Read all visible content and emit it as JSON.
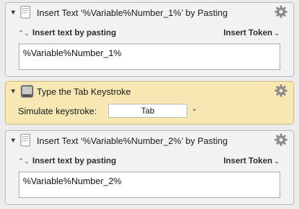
{
  "actions": [
    {
      "title": "Insert Text ‘%Variable%Number_1%’ by Pasting",
      "mode": "Insert text by pasting",
      "token_button": "Insert Token",
      "text": "%Variable%Number_1%"
    },
    {
      "title": "Type the Tab Keystroke",
      "simulate_label": "Simulate keystroke:",
      "keystroke": "Tab"
    },
    {
      "title": "Insert Text ‘%Variable%Number_2%’ by Pasting",
      "mode": "Insert text by pasting",
      "token_button": "Insert Token",
      "text": "%Variable%Number_2%"
    }
  ],
  "icons": {
    "disclosure": "disclosure-triangle-down",
    "gear": "gear-icon",
    "doc": "document-icon",
    "app": "keyboard-app-icon",
    "updown": "up-down-chevron-icon",
    "chevron": "chevron-down-icon"
  },
  "glyphs": {
    "disclosure": "▼",
    "updown": "⌃⌄",
    "chevron": "⌄"
  }
}
